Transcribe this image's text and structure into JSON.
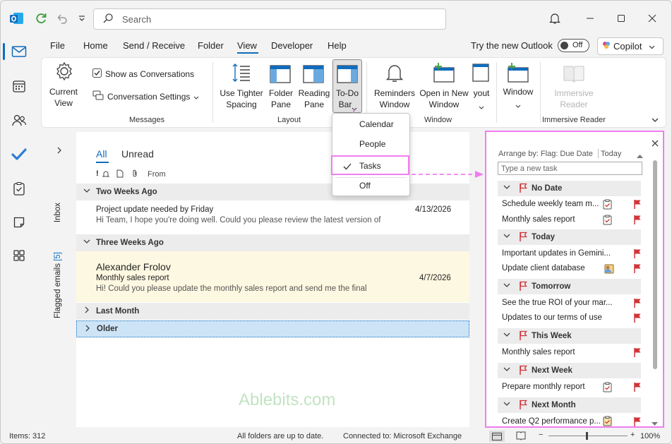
{
  "titlebar": {
    "search_placeholder": "Search"
  },
  "menu": {
    "file": "File",
    "home": "Home",
    "send_receive": "Send / Receive",
    "folder": "Folder",
    "view": "View",
    "developer": "Developer",
    "help": "Help",
    "try_new": "Try the new Outlook",
    "toggle": "Off",
    "copilot": "Copilot"
  },
  "ribbon": {
    "current_view": "Current View",
    "show_conv": "Show as Conversations",
    "conv_settings": "Conversation Settings",
    "messages_group": "Messages",
    "use_tighter_1": "Use Tighter",
    "use_tighter_2": "Spacing",
    "folder_pane_1": "Folder",
    "folder_pane_2": "Pane",
    "reading_pane_1": "Reading",
    "reading_pane_2": "Pane",
    "todo_bar_1": "To-Do",
    "todo_bar_2": "Bar",
    "layout_group": "Layout",
    "reminders_1": "Reminders",
    "reminders_2": "Window",
    "open_new_1": "Open in New",
    "open_new_2": "Window",
    "layout_cut": "yout",
    "window_group": "Window",
    "window_btn": "Window",
    "immersive_1": "Immersive",
    "immersive_2": "Reader",
    "immersive_group": "Immersive Reader"
  },
  "dropdown": {
    "calendar": "Calendar",
    "people": "People",
    "tasks": "Tasks",
    "off": "Off"
  },
  "folderbar": {
    "inbox": "Inbox",
    "flagged": "Flagged emails",
    "flagged_count": "[5]"
  },
  "mail": {
    "tab_all": "All",
    "tab_unread": "Unread",
    "col_from": "From",
    "groups": {
      "two_weeks": "Two Weeks Ago",
      "three_weeks": "Three Weeks Ago",
      "last_month": "Last Month",
      "older": "Older"
    },
    "m1": {
      "subject": "Project update needed by Friday",
      "preview": "Hi Team,  I hope you're doing well.  Could you please review the latest version of",
      "date": "4/13/2026"
    },
    "m2": {
      "sender": "Alexander Frolov",
      "subject": "Monthly sales report",
      "preview": "Hi!  Could you please update the monthly sales report and send me the final",
      "date": "4/7/2026"
    },
    "watermark": "Ablebits.com"
  },
  "todo": {
    "arrange": "Arrange by: Flag: Due Date",
    "today_sort": "Today",
    "new_task": "Type a new task",
    "g_nodate": "No Date",
    "t1": "Schedule weekly team m...",
    "t2": "Monthly sales report",
    "g_today": "Today",
    "t3": "Important updates in Gemini...",
    "t4": "Update client database",
    "g_tomorrow": "Tomorrow",
    "t5": "See the true ROI of your mar...",
    "t6": "Updates to our terms of use",
    "g_thisweek": "This Week",
    "t7": "Monthly sales report",
    "g_nextweek": "Next Week",
    "t8": "Prepare monthly report",
    "g_nextmonth": "Next Month",
    "t9": "Create Q2 performance p..."
  },
  "status": {
    "items": "Items: 312",
    "sync": "All folders are up to date.",
    "conn": "Connected to: Microsoft Exchange",
    "zoom": "100%"
  },
  "colors": {
    "accent": "#0f6cbd",
    "flag": "#d13438",
    "highlight": "#f07ef0",
    "selected_row": "#fdf8e1"
  }
}
